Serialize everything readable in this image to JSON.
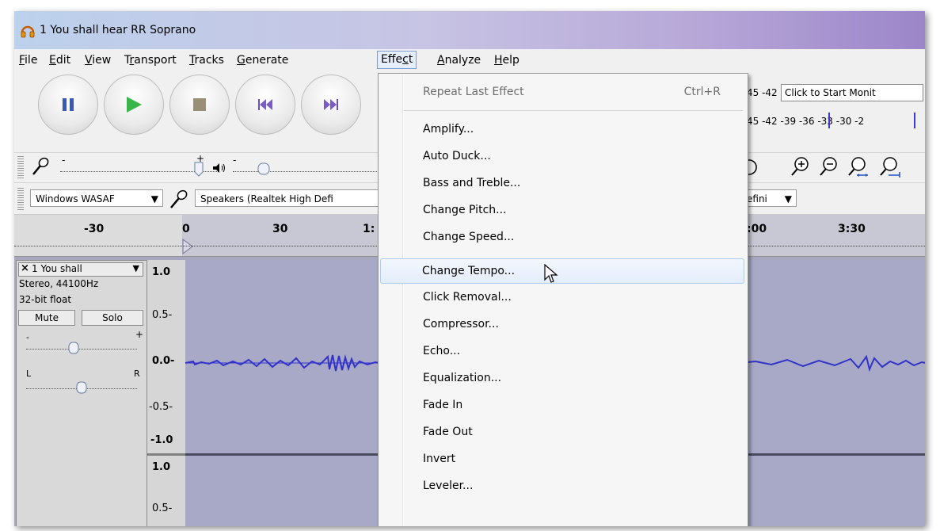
{
  "window": {
    "title": "1 You shall hear RR Soprano",
    "titlebar_colors": [
      "#bcd1ec",
      "#9c86c9"
    ]
  },
  "menubar": {
    "items": [
      {
        "label": "File",
        "underline": "F"
      },
      {
        "label": "Edit",
        "underline": "E"
      },
      {
        "label": "View",
        "underline": "V"
      },
      {
        "label": "Transport",
        "underline": "r"
      },
      {
        "label": "Tracks",
        "underline": "T"
      },
      {
        "label": "Generate",
        "underline": "G"
      },
      {
        "label": "Effect",
        "underline": "c"
      },
      {
        "label": "Analyze",
        "underline": "A"
      },
      {
        "label": "Help",
        "underline": "H"
      }
    ]
  },
  "transport": {
    "buttons": [
      "pause-icon",
      "play-icon",
      "stop-icon",
      "skip-start-icon",
      "skip-end-icon"
    ]
  },
  "meters": {
    "record_scale": "45 -42 -3",
    "monitor_button": "Click to Start Monit",
    "play_scale": "45 -42 -39 -36 -33 -30 -2"
  },
  "devices": {
    "host": "Windows WASAF",
    "output": "Speakers (Realtek High Defi",
    "input_partial": "efini"
  },
  "timeline": {
    "labels": [
      "-30",
      "0",
      "30",
      "1:",
      ":00",
      "3:30"
    ]
  },
  "track": {
    "name": "1 You shall",
    "format": "Stereo, 44100Hz",
    "bitdepth": "32-bit float",
    "mute": "Mute",
    "solo": "Solo",
    "gain_minus": "-",
    "gain_plus": "+",
    "pan_left": "L",
    "pan_right": "R",
    "scale_top": [
      "1.0",
      "0.5-",
      "0.0-",
      "-0.5-",
      "-1.0"
    ],
    "scale_bottom": [
      "1.0",
      "0.5-"
    ],
    "waveform_color": "#3232c8"
  },
  "effect_menu": {
    "repeat": {
      "label": "Repeat Last Effect",
      "shortcut": "Ctrl+R"
    },
    "items": [
      "Amplify...",
      "Auto Duck...",
      "Bass and Treble...",
      "Change Pitch...",
      "Change Speed...",
      "Change Tempo...",
      "Click Removal...",
      "Compressor...",
      "Echo...",
      "Equalization...",
      "Fade In",
      "Fade Out",
      "Invert",
      "Leveler..."
    ],
    "highlighted": "Change Tempo..."
  }
}
